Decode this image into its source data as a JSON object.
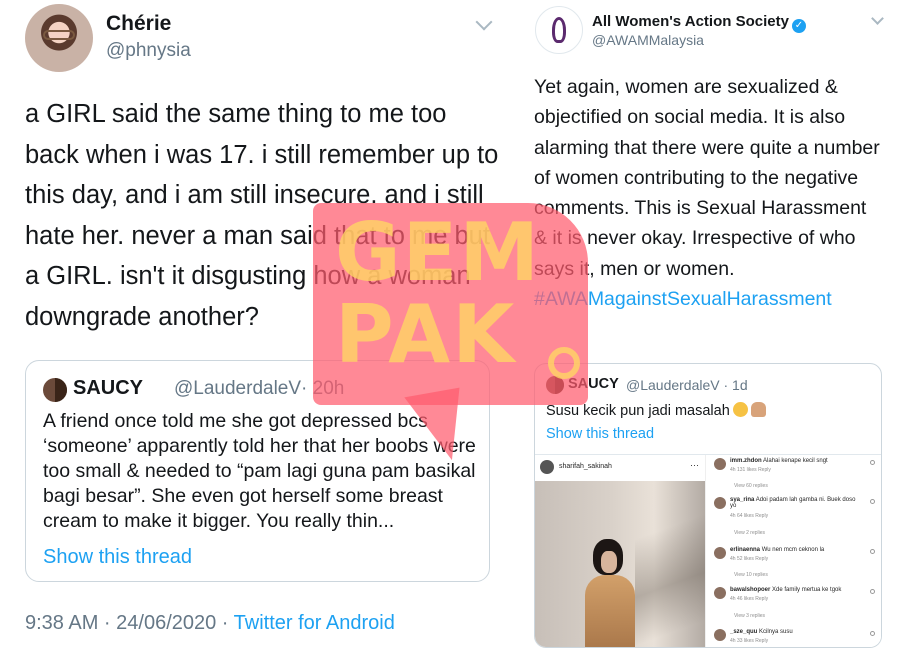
{
  "left_tweet": {
    "author_name": "Chérie",
    "author_handle": "@phnysia",
    "text": "a GIRL said the same thing to me too back when i was 17. i still remember up to this day, and i am still insecure. and i still hate her. never a man said that to me but a GIRL. isn't it disgusting how a woman downgrade another?",
    "quoted": {
      "author_name": "SAUCY",
      "author_handle": "@LauderdaleV",
      "time": "· 20h",
      "text": "A friend once told me she got depressed bcs ‘someone’ apparently told her that her boobs were too small & needed to “pam lagi guna pam basikal bagi besar”. She even got herself some breast cream to make it bigger. You really thin...",
      "show_thread": "Show this thread"
    },
    "timestamp": "9:38 AM · 24/06/2020 · ",
    "source": "Twitter for Android"
  },
  "right_tweet": {
    "author_name": "All Women's Action Society",
    "verified_glyph": "✓",
    "author_handle": "@AWAMMalaysia",
    "text": "Yet again, women are sexualized & objectified on social media. It is also alarming that there were quite a number of women contributing to the negative comments. This is Sexual Harassment & it is never okay. Irrespective of who says it, men or women.",
    "hashtag": "#AWAMagainstSexualHarassment",
    "quoted": {
      "author_name": "SAUCY",
      "author_handle": "@LauderdaleV · 1d",
      "text": "Susu kecik pun jadi masalah",
      "show_thread": "Show this thread",
      "instagram": {
        "username": "sharifah_sakinah",
        "dots": "···",
        "comments": [
          {
            "user": "imm.zhdon",
            "text": "Alahai kenape kecil sngt",
            "meta": "4h    131 likes    Reply",
            "replies": "View 60 replies"
          },
          {
            "user": "sya_rina",
            "text": "Adoi padam lah gamba ni. Buek doso",
            "text2": "yo",
            "meta": "4h    64 likes    Reply",
            "replies": "View 2 replies"
          },
          {
            "user": "erlinaenna",
            "text": "Wu nen mcm ceknon la",
            "meta": "4h    52 likes    Reply",
            "replies": "View 10 replies"
          },
          {
            "user": "bawalshopoer",
            "text": "Xde family mertua ke tgok",
            "meta": "4h    46 likes    Reply",
            "replies": "View 3 replies"
          },
          {
            "user": "_sze_quu",
            "text": "Kcilnya susu",
            "meta": "4h    33 likes    Reply",
            "replies": ""
          }
        ]
      }
    }
  },
  "watermark": {
    "line1": "GEM",
    "line2": "PAK",
    "color": "#ff5c6e"
  }
}
